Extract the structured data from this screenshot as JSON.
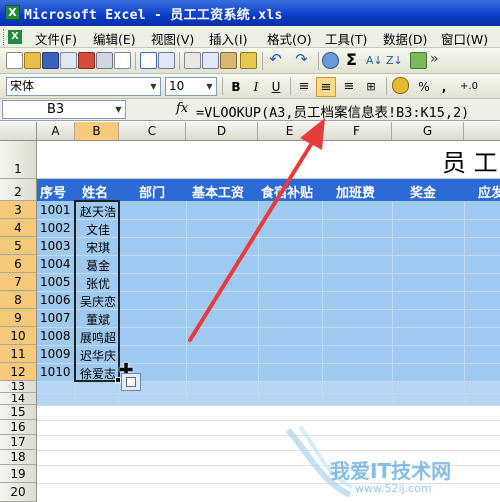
{
  "window": {
    "title": "Microsoft Excel - 员工工资系统.xls",
    "app_icon": "excel-icon"
  },
  "menu": {
    "items": [
      "文件(F)",
      "编辑(E)",
      "视图(V)",
      "插入(I)",
      "格式(O)",
      "工具(T)",
      "数据(D)",
      "窗口(W)"
    ]
  },
  "format_toolbar": {
    "font": "宋体",
    "size": "10",
    "bold": "B",
    "italic": "I",
    "underline": "U",
    "percent": "%",
    "comma": ",",
    "dec_increase": "+.0"
  },
  "formula_bar": {
    "cell_ref": "B3",
    "fx": "fx",
    "formula": "=VLOOKUP(A3,员工档案信息表!B3:K15,2)"
  },
  "columns": [
    "A",
    "B",
    "C",
    "D",
    "E",
    "F",
    "G"
  ],
  "rows": [
    "1",
    "2",
    "3",
    "4",
    "5",
    "6",
    "7",
    "8",
    "9",
    "10",
    "11",
    "12",
    "13",
    "14",
    "15",
    "16",
    "17",
    "18",
    "19",
    "20"
  ],
  "sheet": {
    "title_partial": "员 工",
    "headers": [
      "序号",
      "姓名",
      "部门",
      "基本工资",
      "食宿补贴",
      "加班费",
      "奖金",
      "应发"
    ],
    "records": [
      {
        "id": "1001",
        "name": "赵天浩"
      },
      {
        "id": "1002",
        "name": "文佳"
      },
      {
        "id": "1003",
        "name": "宋琪"
      },
      {
        "id": "1004",
        "name": "葛金"
      },
      {
        "id": "1005",
        "name": "张优"
      },
      {
        "id": "1006",
        "name": "吴庆恋"
      },
      {
        "id": "1007",
        "name": "董斌"
      },
      {
        "id": "1008",
        "name": "展鸣超"
      },
      {
        "id": "1009",
        "name": "迟华庆"
      },
      {
        "id": "1010",
        "name": "徐爱志"
      }
    ]
  },
  "watermark": {
    "text": "我爱IT技术网",
    "url": "www.52ij.com"
  },
  "colors": {
    "header_fill": "#2c6ad6",
    "cell_fill": "#9ec9f0",
    "selection_header": "#f7c97a",
    "arrow": "#e83b3b"
  }
}
